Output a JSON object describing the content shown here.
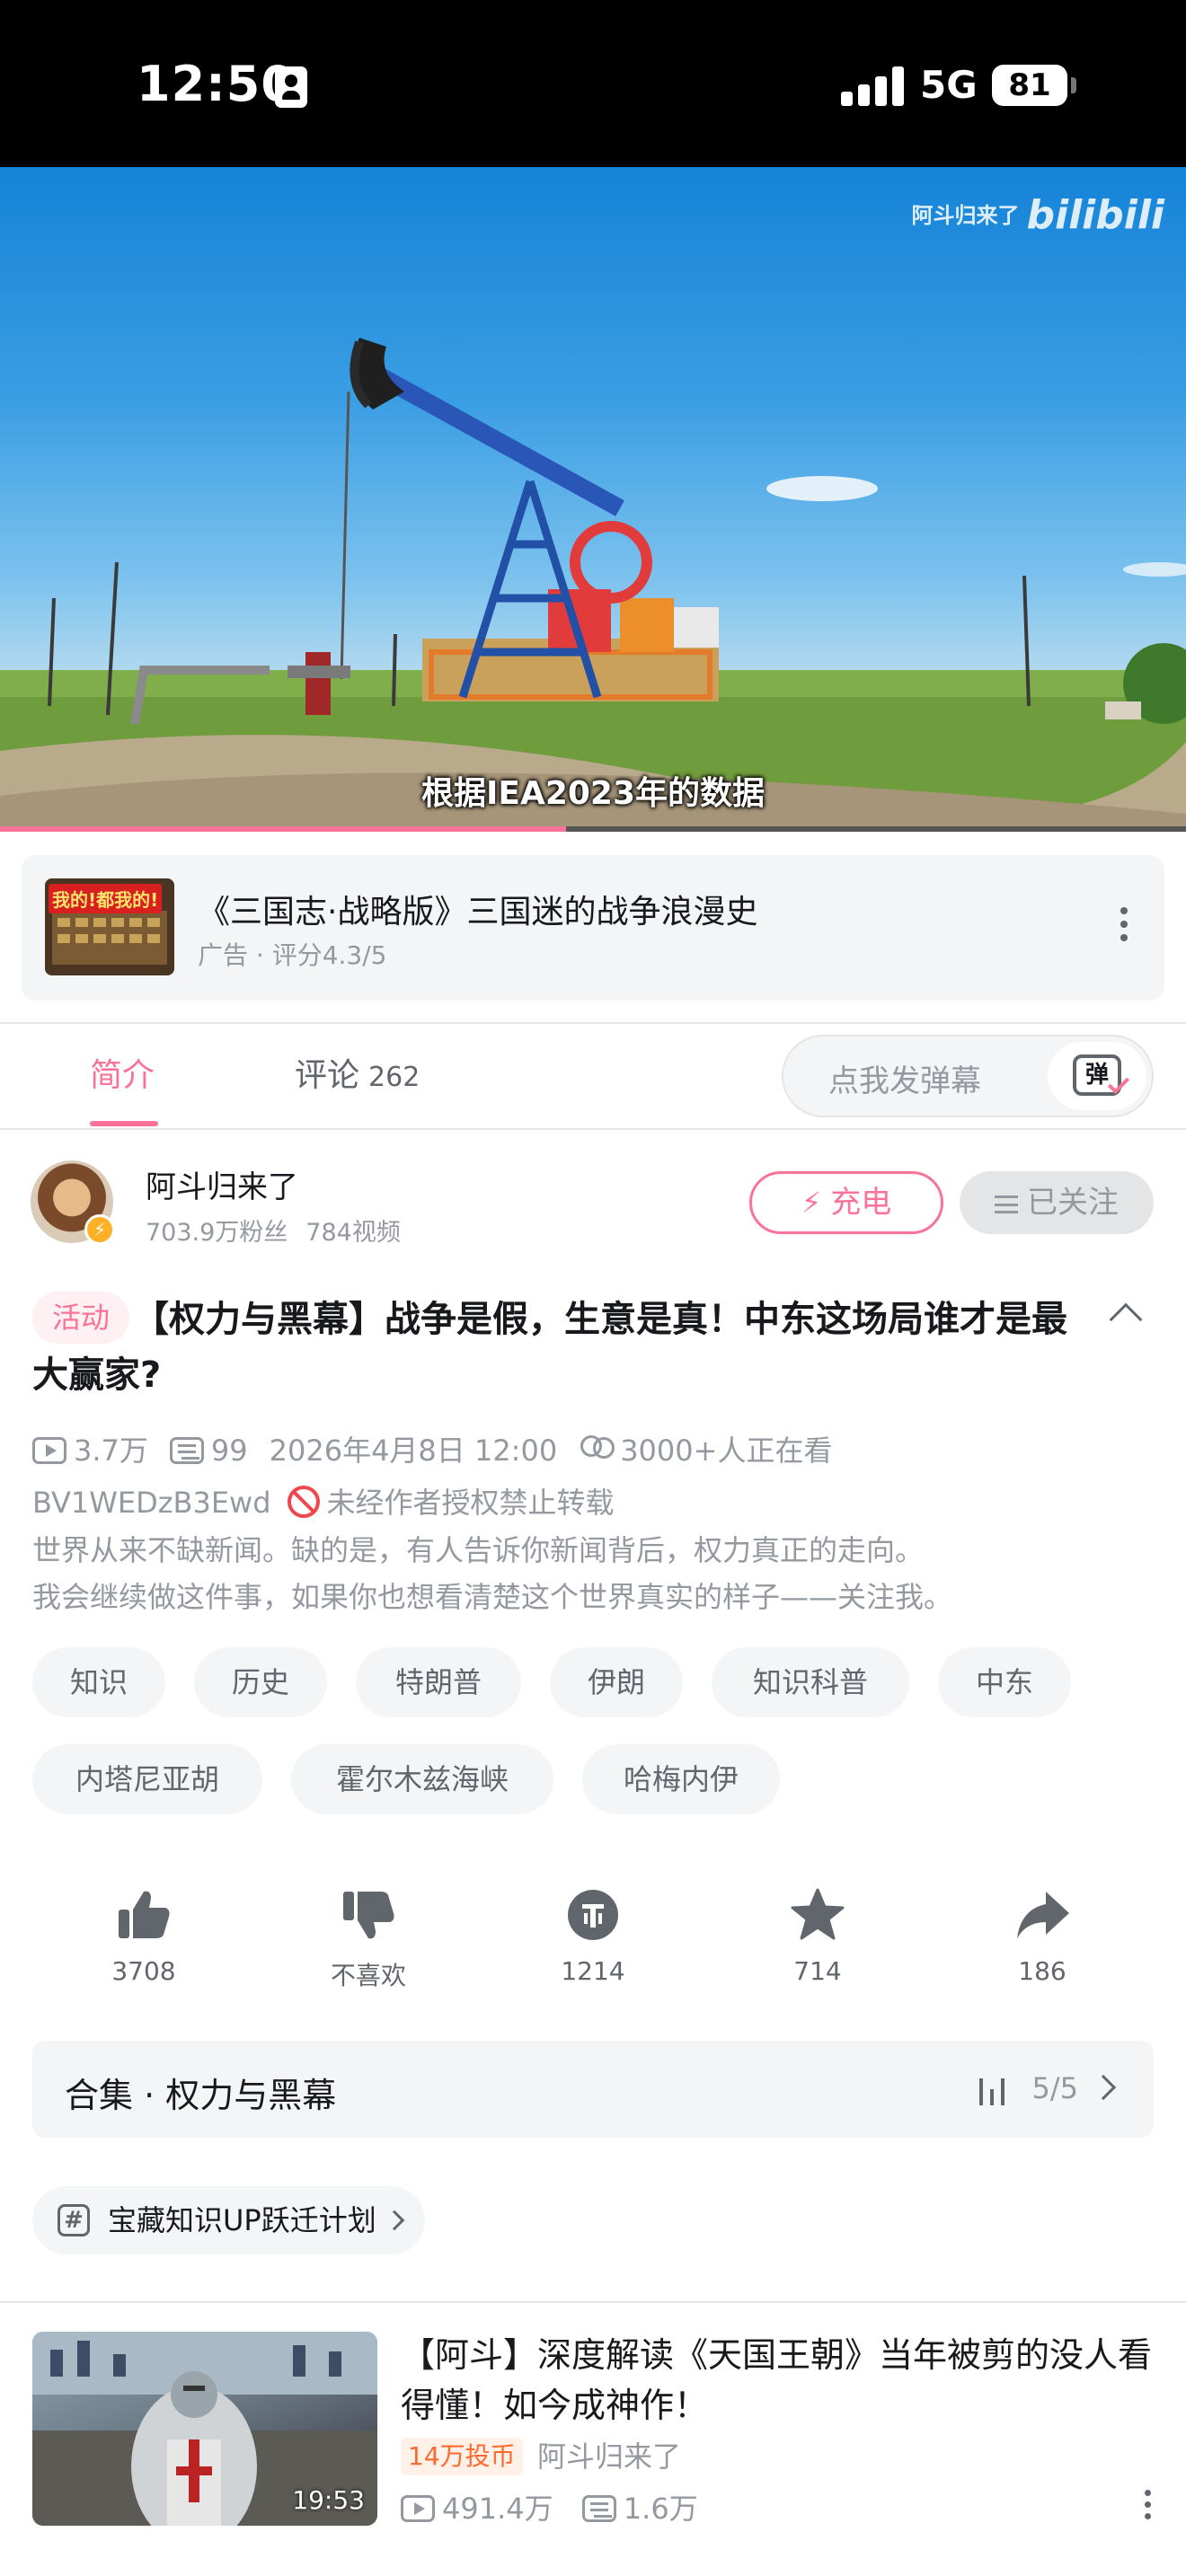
{
  "status_bar": {
    "time": "12:50",
    "network": "5G",
    "battery": "81"
  },
  "player": {
    "watermark_text": "阿斗归来了",
    "watermark_logo": "bilibili",
    "subtitle": "根据IEA2023年的数据",
    "progress": 0.477
  },
  "ad": {
    "thumb_text": "我的!都我的!",
    "title": "《三国志·战略版》三国迷的战争浪漫史",
    "subtitle": "广告 · 评分4.3/5"
  },
  "tabs": {
    "intro": "简介",
    "comments": "评论",
    "comment_count": "262",
    "danmu_placeholder": "点我发弹幕",
    "danmu_icon_text": "弹"
  },
  "uploader": {
    "name": "阿斗归来了",
    "fans": "703.9万粉丝",
    "videos": "784视频",
    "charge_label": "充电",
    "follow_label": "已关注"
  },
  "video": {
    "activity_tag": "活动",
    "title": "【权力与黑幕】战争是假，生意是真！中东这场局谁才是最大赢家?",
    "views": "3.7万",
    "danmaku": "99",
    "date": "2026年4月8日 12:00",
    "watching": "3000+人正在看",
    "bvid": "BV1WEDzB3Ewd",
    "copyright": "未经作者授权禁止转载",
    "description": [
      "世界从来不缺新闻。缺的是，有人告诉你新闻背后，权力真正的走向。",
      "我会继续做这件事，如果你也想看清楚这个世界真实的样子——关注我。"
    ],
    "tags": [
      "知识",
      "历史",
      "特朗普",
      "伊朗",
      "知识科普",
      "中东",
      "内塔尼亚胡",
      "霍尔木兹海峡",
      "哈梅内伊"
    ]
  },
  "actions": {
    "like": "3708",
    "dislike": "不喜欢",
    "coin": "1214",
    "favorite": "714",
    "share": "186"
  },
  "collection": {
    "title": "合集 · 权力与黑幕",
    "progress": "5/5"
  },
  "plan": {
    "label": "宝藏知识UP跃迁计划"
  },
  "recommended": {
    "title": "【阿斗】深度解读《天国王朝》当年被剪的没人看得懂！如今成神作！",
    "duration": "19:53",
    "badge": "14万投币",
    "author": "阿斗归来了",
    "views": "491.4万",
    "danmaku": "1.6万"
  },
  "colors": {
    "accent": "#fb7299",
    "muted": "#9499a0",
    "text": "#18191c",
    "danger": "#f0464d"
  }
}
